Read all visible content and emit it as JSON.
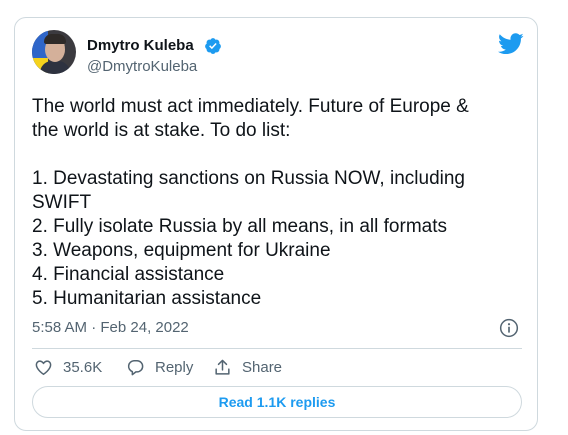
{
  "author": {
    "name": "Dmytro Kuleba",
    "handle": "@DmytroKuleba",
    "verified": true,
    "avatar_icon": "profile-photo"
  },
  "brand": {
    "icon": "twitter-bird-icon",
    "color": "#1d9bf0"
  },
  "tweet": {
    "lines": [
      "The world must act immediately. Future of Europe &",
      "the world is at stake. To do list:",
      "",
      "1. Devastating sanctions on Russia NOW, including",
      "SWIFT",
      "2. Fully isolate Russia by all means, in all formats",
      "3. Weapons, equipment for Ukraine",
      "4. Financial assistance",
      "5. Humanitarian assistance"
    ],
    "timestamp": "5:58 AM · Feb 24, 2022",
    "info_icon": "info-icon"
  },
  "actions": {
    "likes": "35.6K",
    "reply_label": "Reply",
    "share_label": "Share"
  },
  "read_replies_label": "Read 1.1K replies",
  "colors": {
    "text": "#0f1419",
    "secondary": "#536471",
    "border": "#cfd9de",
    "accent": "#1d9bf0"
  }
}
